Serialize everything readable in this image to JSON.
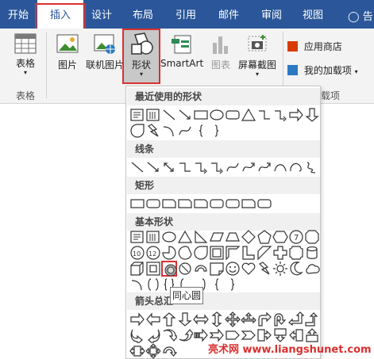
{
  "tabs": [
    {
      "label": "开始"
    },
    {
      "label": "插入"
    },
    {
      "label": "设计"
    },
    {
      "label": "布局"
    },
    {
      "label": "引用"
    },
    {
      "label": "邮件"
    },
    {
      "label": "审阅"
    },
    {
      "label": "视图"
    }
  ],
  "tell_me": "告",
  "ribbon": {
    "table_btn": "表格",
    "table_group": "表格",
    "picture_btn": "图片",
    "online_picture_btn": "联机图片",
    "shapes_btn": "形状",
    "smartart_btn": "SmartArt",
    "chart_btn": "图表",
    "screenshot_btn": "屏幕截图",
    "store_btn": "应用商店",
    "myaddins_btn": "我的加载项",
    "addins_group": "载项"
  },
  "gallery": {
    "recent": "最近使用的形状",
    "lines": "线条",
    "rectangles": "矩形",
    "basic": "基本形状",
    "arrows": "箭头总汇"
  },
  "tooltip": "同心圆",
  "watermark": "亮术网 www.liangshunet.com",
  "colors": {
    "ribbon_blue": "#2b579a",
    "highlight_red": "#d9302f"
  }
}
